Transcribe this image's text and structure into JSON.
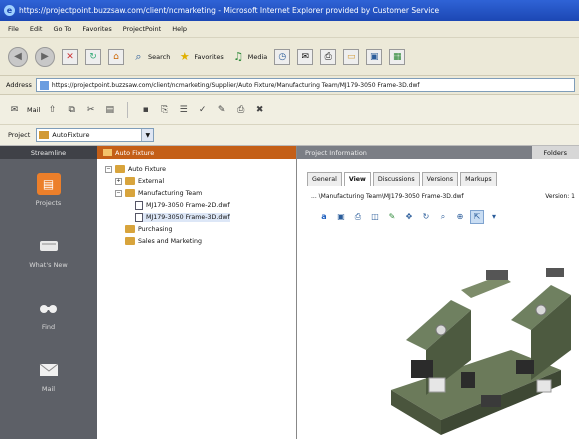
{
  "window": {
    "title": "https://projectpoint.buzzsaw.com/client/ncmarketing - Microsoft Internet Explorer provided by Customer Service"
  },
  "menubar": [
    "File",
    "Edit",
    "Go To",
    "Favorites",
    "ProjectPoint",
    "Help"
  ],
  "toolbar": {
    "search_label": "Search",
    "favorites_label": "Favorites",
    "media_label": "Media"
  },
  "address": {
    "label": "Address",
    "value": "https://projectpoint.buzzsaw.com/client/ncmarketing/Supplier/Auto Fixture/Manufacturing Team/MJ179-3050 Frame-3D.dwf"
  },
  "apptoolbar": {
    "mail_label": "Mail"
  },
  "project": {
    "label": "Project",
    "selected": "AutoFixture"
  },
  "sidebar": {
    "header": "Streamline",
    "items": [
      {
        "label": "Projects",
        "icon": "projects-icon"
      },
      {
        "label": "What's New",
        "icon": "whats-new-icon"
      },
      {
        "label": "Find",
        "icon": "find-icon"
      },
      {
        "label": "Mail",
        "icon": "mail-icon"
      }
    ]
  },
  "tree": {
    "header": "Auto Fixture",
    "nodes": [
      {
        "label": "Auto Fixture",
        "type": "folder",
        "toggle": "−"
      },
      {
        "label": "External",
        "type": "folder",
        "toggle": "+"
      },
      {
        "label": "Manufacturing Team",
        "type": "folder",
        "toggle": "−"
      },
      {
        "label": "MJ179-3050 Frame-2D.dwf",
        "type": "file",
        "toggle": ""
      },
      {
        "label": "MJ179-3050 Frame-3D.dwf",
        "type": "file",
        "toggle": ""
      },
      {
        "label": "Purchasing",
        "type": "folder",
        "toggle": ""
      },
      {
        "label": "Sales and Marketing",
        "type": "folder",
        "toggle": ""
      }
    ]
  },
  "rightpanel": {
    "header": "Project Information",
    "folders_tab": "Folders",
    "tabs": [
      "General",
      "View",
      "Discussions",
      "Versions",
      "Markups"
    ],
    "active_tab": "View",
    "path": "... \\Manufacturing Team\\MJ179-3050 Frame-3D.dwf",
    "version": "Version: 1"
  },
  "colors": {
    "title_blue": "#1c47b4",
    "accent_orange": "#ec7f2a",
    "sidebar_gray": "#5d6067"
  }
}
